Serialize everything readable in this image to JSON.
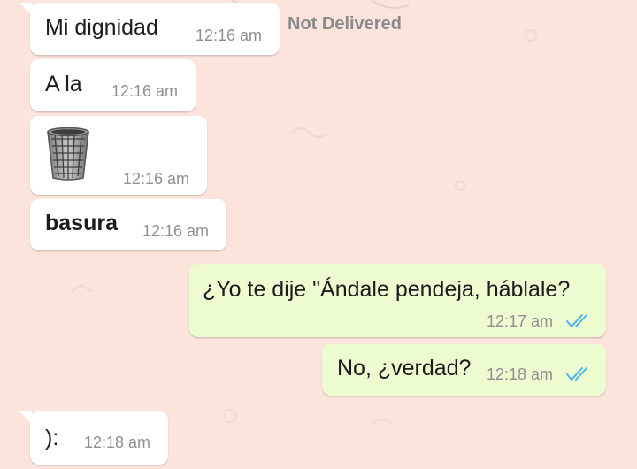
{
  "chat": {
    "status_note": "Not Delivered",
    "messages": [
      {
        "text": "Mi dignidad",
        "time": "12:16 am",
        "direction": "incoming"
      },
      {
        "text": "A la",
        "time": "12:16 am",
        "direction": "incoming"
      },
      {
        "icon": "wastebasket-icon",
        "time": "12:16 am",
        "direction": "incoming"
      },
      {
        "text": "basura",
        "time": "12:16 am",
        "direction": "incoming"
      },
      {
        "text": "¿Yo te dije \"Ándale pendeja, háblale?",
        "time": "12:17 am",
        "direction": "outgoing",
        "status": "read"
      },
      {
        "text": "No, ¿verdad?",
        "time": "12:18 am",
        "direction": "outgoing",
        "status": "read"
      },
      {
        "text": "):",
        "time": "12:18 am",
        "direction": "incoming"
      }
    ]
  },
  "colors": {
    "background": "#fce4dc",
    "incoming_bubble": "#ffffff",
    "outgoing_bubble": "#ecfbd0",
    "read_ticks": "#4fb5e8",
    "timestamp": "#8f8f8f"
  }
}
